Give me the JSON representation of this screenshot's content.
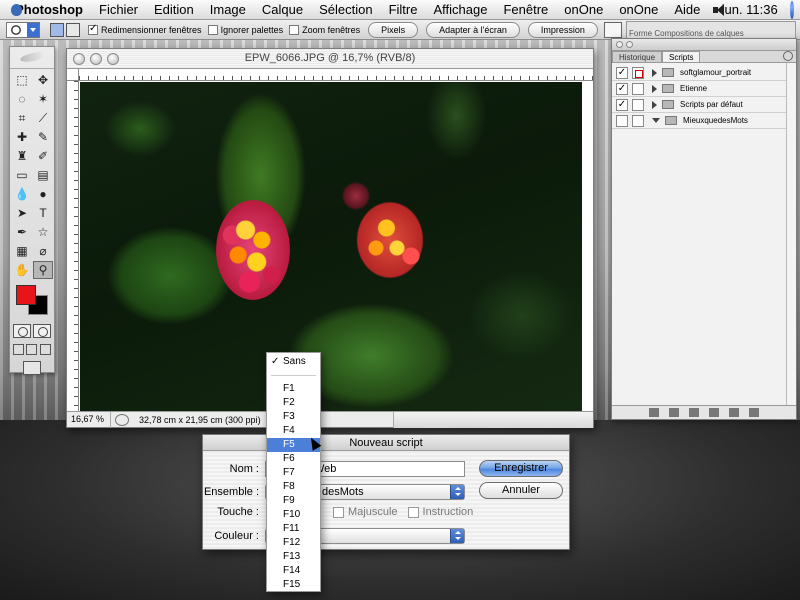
{
  "menubar": {
    "app": "Photoshop",
    "items": [
      "Fichier",
      "Edition",
      "Image",
      "Calque",
      "Sélection",
      "Filtre",
      "Affichage",
      "Fenêtre",
      "onOne",
      "onOne",
      "Aide"
    ],
    "clock": "lun. 11:36"
  },
  "options": {
    "chk_resize": "Redimensionner fenêtres",
    "chk_ignore": "Ignorer palettes",
    "chk_zoomall": "Zoom fenêtres",
    "btn_pixels": "Pixels",
    "btn_fit": "Adapter à l'écran",
    "btn_print": "Impression",
    "palette_well_tabs": "Forme Compositions de calques"
  },
  "document": {
    "title": "EPW_6066.JPG @ 16,7% (RVB/8)",
    "zoom": "16,67 %",
    "size": "32,78 cm x 21,95 cm (300 ppi)"
  },
  "palette": {
    "tabs": [
      "Historique",
      "Scripts"
    ],
    "rows": [
      {
        "label": "softglamour_portrait",
        "checked": true,
        "dialog": true,
        "expanded": false
      },
      {
        "label": "Etienne",
        "checked": true,
        "dialog": false,
        "expanded": false
      },
      {
        "label": "Scripts par défaut",
        "checked": true,
        "dialog": false,
        "expanded": false
      },
      {
        "label": "MieuxquedesMots",
        "checked": false,
        "dialog": false,
        "expanded": true
      }
    ]
  },
  "dialog": {
    "title": "Nouveau script",
    "nom_label": "Nom :",
    "nom_value": "Web",
    "ensemble_label": "Ensemble :",
    "ensemble_value": "desMots",
    "touche_label": "Touche :",
    "majuscule": "Majuscule",
    "instruction": "Instruction",
    "couleur_label": "Couleur :",
    "btn_save": "Enregistrer",
    "btn_cancel": "Annuler"
  },
  "dropdown": {
    "checked": "Sans",
    "highlighted": "F5",
    "items": [
      "F1",
      "F2",
      "F3",
      "F4",
      "F5",
      "F6",
      "F7",
      "F8",
      "F9",
      "F10",
      "F11",
      "F12",
      "F13",
      "F14",
      "F15"
    ]
  }
}
